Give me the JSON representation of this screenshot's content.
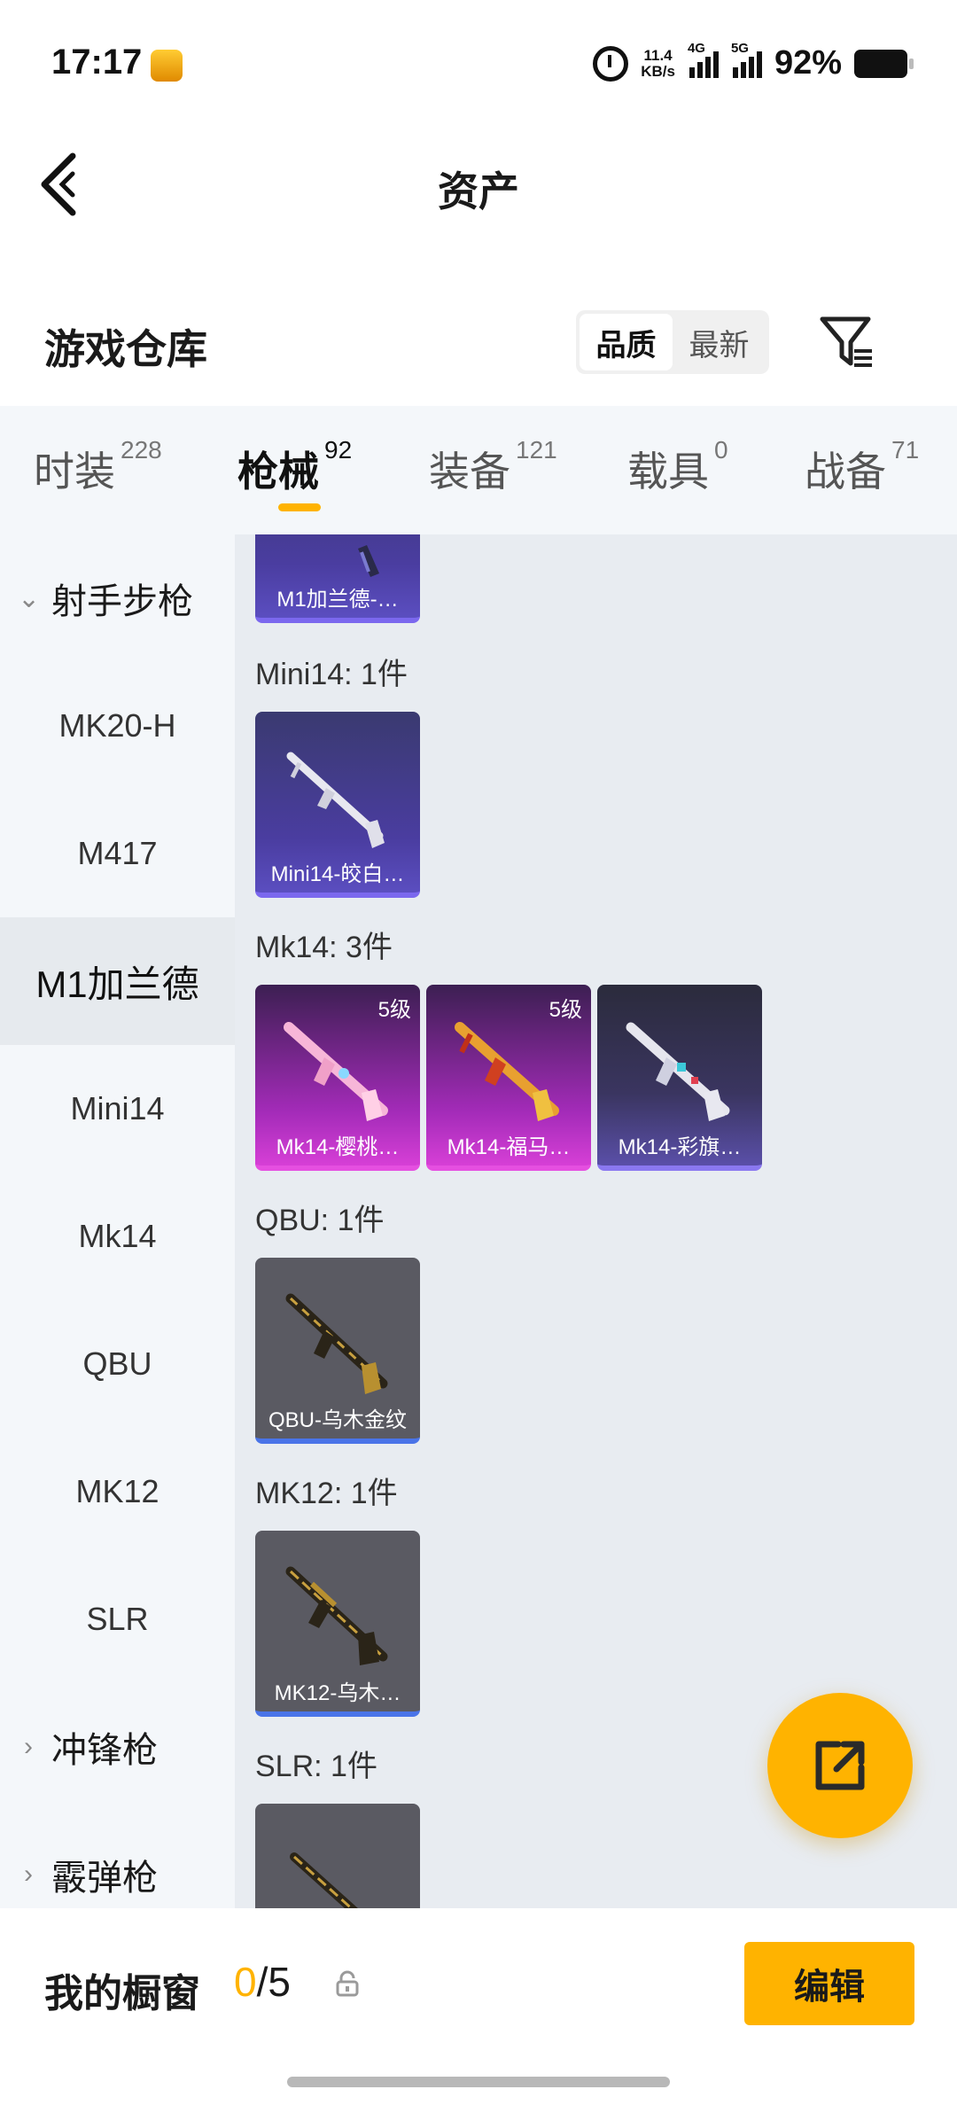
{
  "status_bar": {
    "time": "17:17",
    "net_speed_value": "11.4",
    "net_speed_unit": "KB/s",
    "signal_1": "4G",
    "signal_2": "5G",
    "battery_percent": "92%"
  },
  "header": {
    "title": "资产"
  },
  "section": {
    "title": "游戏仓库",
    "sort_options": [
      "品质",
      "最新"
    ],
    "active_sort": "品质"
  },
  "tabs": [
    {
      "label": "时装",
      "count": "228"
    },
    {
      "label": "枪械",
      "count": "92",
      "active": true
    },
    {
      "label": "装备",
      "count": "121"
    },
    {
      "label": "载具",
      "count": "0"
    },
    {
      "label": "战备",
      "count": "71"
    }
  ],
  "sidebar": {
    "items": [
      {
        "label": "射手步枪",
        "type": "group",
        "expanded": true
      },
      {
        "label": "MK20-H"
      },
      {
        "label": "M417"
      },
      {
        "label": "M1加兰德",
        "active": true
      },
      {
        "label": "Mini14"
      },
      {
        "label": "Mk14"
      },
      {
        "label": "QBU"
      },
      {
        "label": "MK12"
      },
      {
        "label": "SLR"
      },
      {
        "label": "冲锋枪",
        "type": "group",
        "expanded": false
      },
      {
        "label": "霰弹枪",
        "type": "group",
        "expanded": false
      }
    ]
  },
  "content": {
    "groups": [
      {
        "label": "",
        "items": [
          {
            "name": "M1加兰德-…",
            "rarity": "purple"
          }
        ]
      },
      {
        "label": "Mini14: 1件",
        "items": [
          {
            "name": "Mini14-皎白…",
            "rarity": "purple"
          }
        ]
      },
      {
        "label": "Mk14: 3件",
        "items": [
          {
            "name": "Mk14-樱桃…",
            "rarity": "pink",
            "level": "5级"
          },
          {
            "name": "Mk14-福马…",
            "rarity": "pink",
            "level": "5级"
          },
          {
            "name": "Mk14-彩旗…",
            "rarity": "navy"
          }
        ]
      },
      {
        "label": "QBU: 1件",
        "items": [
          {
            "name": "QBU-乌木金纹",
            "rarity": "gray"
          }
        ]
      },
      {
        "label": "MK12: 1件",
        "items": [
          {
            "name": "MK12-乌木…",
            "rarity": "gray"
          }
        ]
      },
      {
        "label": "SLR: 1件",
        "items": [
          {
            "name": "",
            "rarity": "gray"
          }
        ]
      }
    ]
  },
  "bottom_bar": {
    "showcase_label": "我的橱窗",
    "showcase_used": "0",
    "showcase_total": "/5",
    "edit_label": "编辑"
  },
  "colors": {
    "accent": "#ffb300",
    "purple_card": "#5b4ec0",
    "pink_card": "#d63fd6",
    "gray_card": "#5a5a62"
  }
}
